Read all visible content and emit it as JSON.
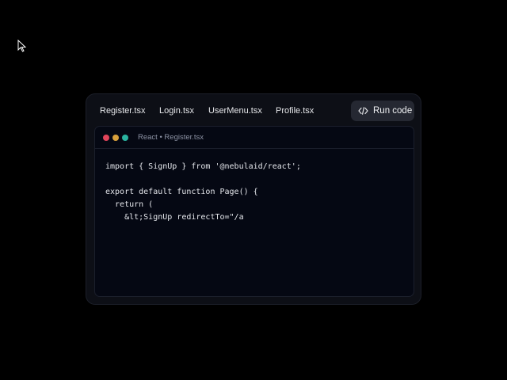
{
  "tabs": [
    {
      "label": "Register.tsx"
    },
    {
      "label": "Login.tsx"
    },
    {
      "label": "UserMenu.tsx"
    },
    {
      "label": "Profile.tsx"
    }
  ],
  "run_button": {
    "label": "Run code",
    "icon": "code-icon"
  },
  "editor": {
    "title": "React • Register.tsx",
    "window_dots": [
      "#e0445a",
      "#d9a13c",
      "#2ab3a0"
    ],
    "code_lines": [
      "import { SignUp } from '@nebulaid/react';",
      "",
      "export default function Page() {",
      "  return (",
      "    &lt;SignUp redirectTo=\"/a"
    ]
  },
  "cursor_icon": "mouse-pointer-icon"
}
